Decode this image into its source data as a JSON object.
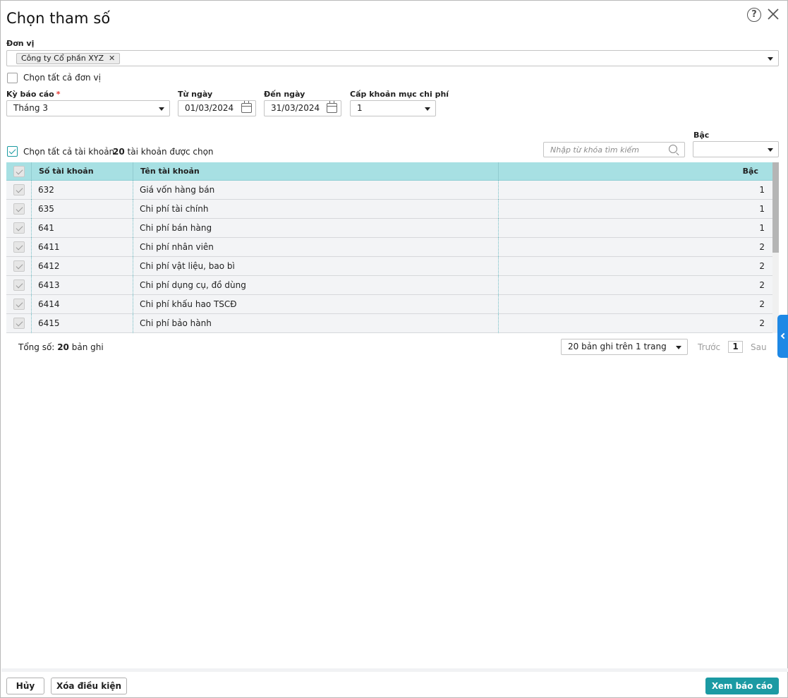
{
  "dialog": {
    "title": "Chọn tham số"
  },
  "unit": {
    "label": "Đơn vị",
    "tags": [
      "Công ty Cổ phần XYZ"
    ],
    "select_all_label": "Chọn tất cả đơn vị"
  },
  "filters": {
    "period_label": "Kỳ báo cáo",
    "period_required_mark": "*",
    "period_value": "Tháng 3",
    "from_label": "Từ ngày",
    "from_value": "01/03/2024",
    "to_label": "Đến ngày",
    "to_value": "31/03/2024",
    "level_label": "Cấp khoản mục chi phí",
    "level_value": "1"
  },
  "accounts": {
    "select_all_label": "Chọn tất cả tài khoản",
    "selected_count": "20",
    "selected_suffix": "tài khoản được chọn",
    "search_placeholder": "Nhập từ khóa tìm kiếm",
    "rank_filter_label": "Bậc",
    "rank_filter_value": ""
  },
  "table": {
    "columns": {
      "code": "Số tài khoản",
      "name": "Tên tài khoản",
      "rank": "Bậc"
    },
    "rows": [
      {
        "code": "632",
        "name": "Giá vốn hàng bán",
        "rank": "1",
        "checked": true
      },
      {
        "code": "635",
        "name": "Chi phí tài chính",
        "rank": "1",
        "checked": true
      },
      {
        "code": "641",
        "name": "Chi phí bán hàng",
        "rank": "1",
        "checked": true
      },
      {
        "code": "6411",
        "name": "Chi phí nhân viên",
        "rank": "2",
        "checked": true
      },
      {
        "code": "6412",
        "name": "Chi phí vật liệu, bao bì",
        "rank": "2",
        "checked": true
      },
      {
        "code": "6413",
        "name": "Chi phí dụng cụ, đồ dùng",
        "rank": "2",
        "checked": true
      },
      {
        "code": "6414",
        "name": "Chi phí khấu hao TSCĐ",
        "rank": "2",
        "checked": true
      },
      {
        "code": "6415",
        "name": "Chi phí bảo hành",
        "rank": "2",
        "checked": true
      }
    ]
  },
  "pagination": {
    "total_prefix": "Tổng số:",
    "total_count": "20",
    "total_suffix": "bản ghi",
    "page_size_option": "20 bản ghi trên 1 trang",
    "prev_label": "Trước",
    "current_page": "1",
    "next_label": "Sau"
  },
  "footer": {
    "cancel_label": "Hủy",
    "clear_label": "Xóa điều kiện",
    "view_report_label": "Xem báo cáo"
  },
  "colors": {
    "accent": "#1b9aa3",
    "header_bg": "#a7e0e3",
    "side_tab": "#1e88e5",
    "required": "#e53935"
  },
  "icons": [
    "help-icon",
    "close-icon",
    "remove-tag-icon",
    "chevron-down-icon",
    "calendar-icon",
    "search-icon",
    "chevron-left-icon"
  ]
}
